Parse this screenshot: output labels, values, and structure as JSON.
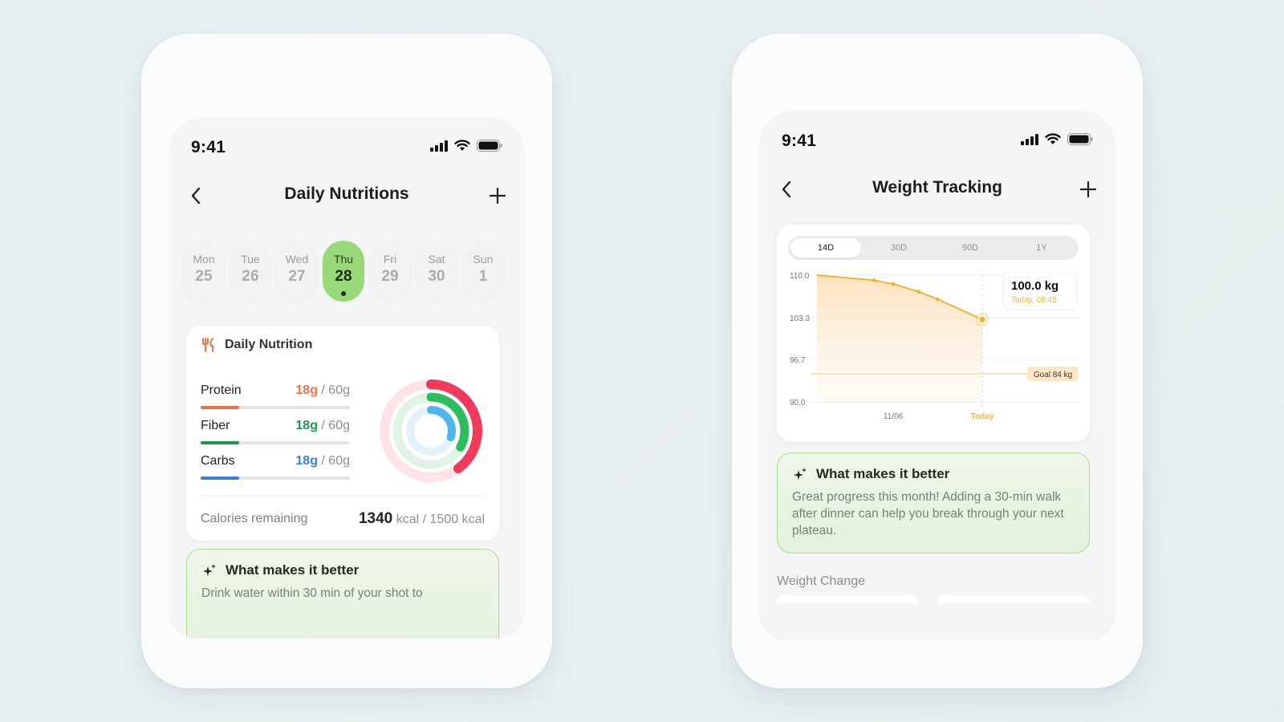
{
  "left_phone": {
    "status": {
      "time": "9:41"
    },
    "nav": {
      "title": "Daily Nutritions"
    },
    "days": [
      {
        "name": "Mon",
        "num": "25",
        "active": false
      },
      {
        "name": "Tue",
        "num": "26",
        "active": false
      },
      {
        "name": "Wed",
        "num": "27",
        "active": false
      },
      {
        "name": "Thu",
        "num": "28",
        "active": true
      },
      {
        "name": "Fri",
        "num": "29",
        "active": false
      },
      {
        "name": "Sat",
        "num": "30",
        "active": false
      },
      {
        "name": "Sun",
        "num": "1",
        "active": false
      }
    ],
    "nutrition": {
      "title": "Daily Nutrition",
      "macros": [
        {
          "name": "Protein",
          "value": "18g",
          "goal": " / 60g",
          "color": "#e8754a",
          "progress": 0.26
        },
        {
          "name": "Fiber",
          "value": "18g",
          "goal": " / 60g",
          "color": "#1e9a4f",
          "progress": 0.26
        },
        {
          "name": "Carbs",
          "value": "18g",
          "goal": " / 60g",
          "color": "#3b7fd6",
          "progress": 0.26
        }
      ],
      "rings": [
        {
          "color": "#f03a5c",
          "track": "#fde2e6",
          "progress": 0.4
        },
        {
          "color": "#2ebd5e",
          "track": "#e0f4e6",
          "progress": 0.33
        },
        {
          "color": "#4fb6ec",
          "track": "#e1f2fb",
          "progress": 0.3
        }
      ],
      "calories_label": "Calories remaining",
      "calories_value": "1340",
      "calories_rest": " kcal / 1500 kcal"
    },
    "tip": {
      "title": "What makes it better",
      "text": "Drink water within 30 min of your shot to"
    }
  },
  "right_phone": {
    "status": {
      "time": "9:41"
    },
    "nav": {
      "title": "Weight Tracking"
    },
    "ranges": [
      {
        "label": "14D",
        "active": true
      },
      {
        "label": "30D",
        "active": false
      },
      {
        "label": "90D",
        "active": false
      },
      {
        "label": "1Y",
        "active": false
      }
    ],
    "tooltip": {
      "value": "100.0 kg",
      "time": "Today, 08:45"
    },
    "goal_label": "Goal 84 kg",
    "tip": {
      "title": "What makes it better",
      "text": "Great progress this month! Adding a 30-min walk after dinner can help you break through your next plateau."
    },
    "weight_change_label": "Weight Change"
  },
  "chart_data": {
    "type": "area",
    "yticks": [
      "110.0",
      "103.3",
      "96.7",
      "90.0"
    ],
    "ylim": [
      90,
      110
    ],
    "xticks": [
      {
        "label": "11/06",
        "x": 6
      },
      {
        "label": "Today",
        "x": 13
      }
    ],
    "xlim": [
      0,
      13
    ],
    "series": [
      {
        "x": [
          0,
          4.5,
          6,
          8,
          9.5,
          13
        ],
        "values": [
          110.0,
          109.2,
          108.6,
          107.4,
          106.2,
          103.0
        ]
      }
    ],
    "goal": 84,
    "accent": "#f0b43a"
  }
}
